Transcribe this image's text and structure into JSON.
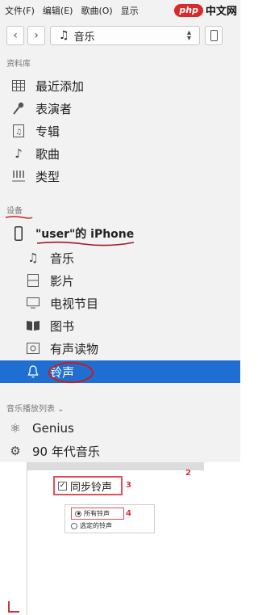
{
  "menubar": {
    "items": [
      "文件(F)",
      "编辑(E)",
      "歌曲(O)",
      "显示"
    ],
    "watermark": {
      "logo": "php",
      "text": "中文网"
    }
  },
  "toolbar": {
    "back_icon": "chevron-left-icon",
    "forward_icon": "chevron-right-icon",
    "source": "音乐",
    "device_icon": "iphone-icon"
  },
  "library": {
    "header": "资料库",
    "items": [
      {
        "label": "最近添加",
        "icon": "grid-icon"
      },
      {
        "label": "表演者",
        "icon": "microphone-icon"
      },
      {
        "label": "专辑",
        "icon": "album-icon"
      },
      {
        "label": "歌曲",
        "icon": "music-note-icon"
      },
      {
        "label": "类型",
        "icon": "genre-icon"
      }
    ]
  },
  "devices": {
    "header": "设备",
    "device_name": "\"user\"的 iPhone",
    "items": [
      {
        "label": "音乐",
        "icon": "music-note-icon"
      },
      {
        "label": "影片",
        "icon": "film-icon"
      },
      {
        "label": "电视节目",
        "icon": "tv-icon"
      },
      {
        "label": "图书",
        "icon": "book-icon"
      },
      {
        "label": "有声读物",
        "icon": "audiobook-icon"
      },
      {
        "label": "铃声",
        "icon": "bell-icon",
        "selected": true
      }
    ]
  },
  "playlists": {
    "header": "音乐播放列表 ⌄",
    "items": [
      {
        "label": "Genius",
        "icon": "genius-atom-icon"
      },
      {
        "label": "90 年代音乐",
        "icon": "gear-icon"
      }
    ]
  },
  "sync_panel": {
    "sync_label": "同步铃声",
    "sync_checked": true,
    "option_all": "所有铃声",
    "option_selected": "选定的铃声",
    "annotations": [
      "2",
      "3",
      "4"
    ]
  },
  "colors": {
    "selection": "#1e6fd1",
    "annotation_red": "#d8323c",
    "sidebar_bg": "#f2f2f2"
  }
}
